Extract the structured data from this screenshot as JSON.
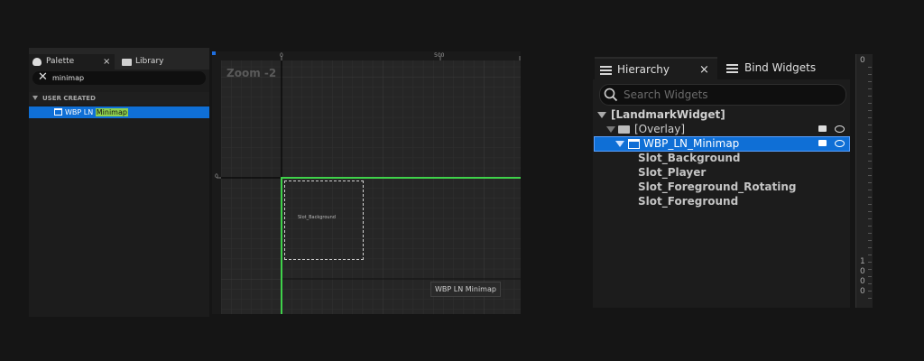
{
  "palette": {
    "tabs": [
      {
        "label": "Palette"
      },
      {
        "label": "Library"
      }
    ],
    "close_glyph": "×",
    "search_value": "minimap",
    "category": "USER CREATED",
    "item": {
      "prefix": "WBP LN ",
      "match": "Minimap"
    }
  },
  "canvas": {
    "zoom": "Zoom -2",
    "ruler_top": [
      "0",
      "500"
    ],
    "ruler_left": [
      "0"
    ],
    "widget_preview_text": "Slot_Background",
    "tooltip": "WBP LN Minimap"
  },
  "hierarchy": {
    "tabs": [
      {
        "label": "Hierarchy"
      },
      {
        "label": "Bind Widgets"
      }
    ],
    "close_glyph": "×",
    "search_placeholder": "Search Widgets",
    "tree": [
      {
        "label": "[LandmarkWidget]"
      },
      {
        "label": "[Overlay]"
      },
      {
        "label": "WBP_LN_Minimap"
      },
      {
        "label": "Slot_Background"
      },
      {
        "label": "Slot_Player"
      },
      {
        "label": "Slot_Foreground_Rotating"
      },
      {
        "label": "Slot_Foreground"
      }
    ]
  },
  "ruler_right": {
    "top": "0",
    "digits": [
      "1",
      "0",
      "0",
      "0"
    ]
  },
  "colors": {
    "selection": "#0f6fd6",
    "highlight": "#8fd14f",
    "widget_outline": "#3fd24a"
  }
}
